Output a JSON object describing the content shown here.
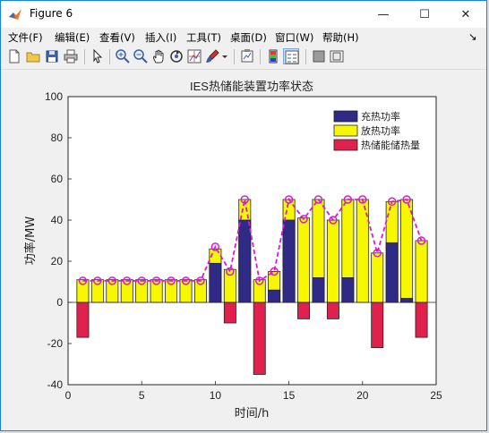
{
  "window": {
    "title": "Figure 6",
    "controls": {
      "minimize": "—",
      "maximize": "☐",
      "close": "✕"
    }
  },
  "menu": {
    "items": [
      {
        "label": "文件(F)"
      },
      {
        "label": "编辑(E)"
      },
      {
        "label": "查看(V)"
      },
      {
        "label": "插入(I)"
      },
      {
        "label": "工具(T)"
      },
      {
        "label": "桌面(D)"
      },
      {
        "label": "窗口(W)"
      },
      {
        "label": "帮助(H)"
      }
    ],
    "overflow": "↘"
  },
  "toolbar": {
    "icons": [
      "new-figure-icon",
      "open-file-icon",
      "save-icon",
      "print-icon",
      "pointer-icon",
      "zoom-in-icon",
      "zoom-out-icon",
      "pan-icon",
      "rotate-icon",
      "data-cursor-icon",
      "brush-icon",
      "brush-dropdown-icon",
      "link-plot-icon",
      "colorbar-icon",
      "legend-icon",
      "hide-plot-tools-icon",
      "show-plot-tools-icon"
    ]
  },
  "colors": {
    "charge": "#2e2a85",
    "discharge": "#f7f700",
    "storage": "#e0214e",
    "line": "#d51cd5"
  },
  "chart_data": {
    "type": "bar",
    "title": "IES热储能装置功率状态",
    "xlabel": "时间/h",
    "ylabel": "功率/MW",
    "xlim": [
      0,
      25
    ],
    "ylim": [
      -40,
      100
    ],
    "xticks": [
      0,
      5,
      10,
      15,
      20,
      25
    ],
    "yticks": [
      -40,
      -20,
      0,
      20,
      40,
      60,
      80,
      100
    ],
    "x": [
      1,
      2,
      3,
      4,
      5,
      6,
      7,
      8,
      9,
      10,
      11,
      12,
      13,
      14,
      15,
      16,
      17,
      18,
      19,
      20,
      21,
      22,
      23,
      24
    ],
    "series": [
      {
        "name": "充热功率",
        "kind": "stacked-bar",
        "values": [
          0,
          0,
          0,
          0,
          0,
          0,
          0,
          0,
          0,
          19,
          0,
          40,
          0,
          6,
          40,
          0,
          12,
          0,
          12,
          0,
          0,
          29,
          2,
          0
        ]
      },
      {
        "name": "放热功率",
        "kind": "stacked-bar",
        "values": [
          11,
          11,
          11,
          11,
          11,
          11,
          11,
          11,
          11,
          26,
          16,
          50,
          11,
          15,
          50,
          41,
          50,
          40,
          50,
          50,
          24,
          49,
          50,
          30
        ]
      },
      {
        "name": "热储能储热量",
        "kind": "bar",
        "values": [
          -17,
          0,
          0,
          0,
          0,
          0,
          0,
          0,
          0,
          0,
          -10,
          0,
          -35,
          0,
          0,
          -8,
          0,
          -8,
          0,
          0,
          -22,
          0,
          0,
          -17
        ]
      },
      {
        "name": "",
        "kind": "line-marker",
        "values": [
          10.5,
          10.5,
          10.5,
          10.5,
          10.5,
          10.5,
          10.5,
          10.5,
          10.5,
          27,
          15,
          50,
          10.5,
          15,
          50,
          40.5,
          50,
          40,
          50,
          50,
          24,
          49,
          50,
          30
        ]
      }
    ],
    "legend": "top-right",
    "grid": false
  }
}
